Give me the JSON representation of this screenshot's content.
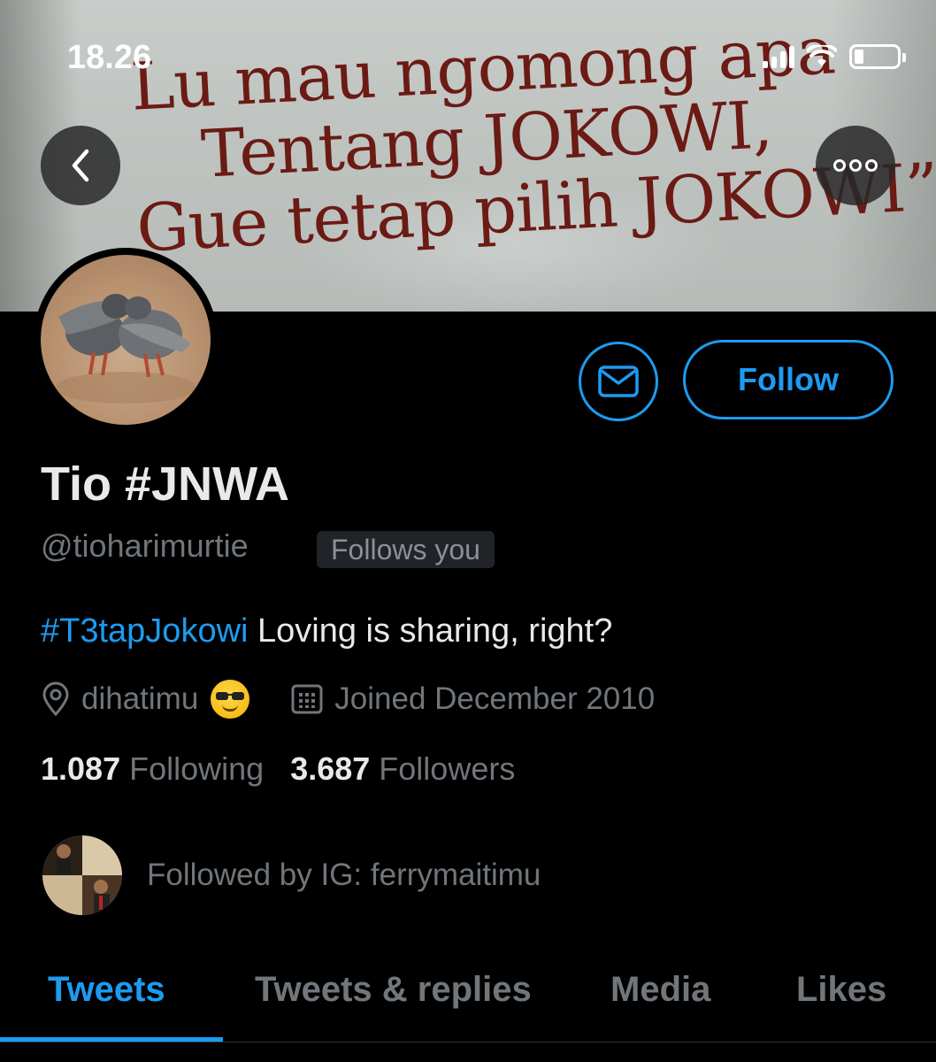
{
  "status_bar": {
    "time": "18.26"
  },
  "banner": {
    "lines": [
      "Lu mau ngomong apa",
      "Tentang JOKOWI,",
      "Gue tetap pilih JOKOWI”"
    ]
  },
  "profile": {
    "display_name": "Tio #JNWA",
    "handle": "@tioharimurtie",
    "follows_you_badge": "Follows you",
    "bio_hashtag": "#T3tapJokowi",
    "bio_text": " Loving is sharing, right?",
    "location": "dihatimu",
    "joined": "Joined December 2010",
    "following_count": "1.087",
    "following_label": "Following",
    "followers_count": "3.687",
    "followers_label": "Followers",
    "followed_by": "Followed by IG: ferrymaitimu"
  },
  "actions": {
    "follow_label": "Follow"
  },
  "tabs": [
    {
      "label": "Tweets",
      "active": true
    },
    {
      "label": "Tweets & replies",
      "active": false
    },
    {
      "label": "Media",
      "active": false
    },
    {
      "label": "Likes",
      "active": false
    }
  ],
  "icons": {
    "back": "chevron-left-icon",
    "more": "more-horizontal-icon",
    "message": "mail-icon",
    "location": "location-pin-icon",
    "calendar": "calendar-icon",
    "emoji": "sunglasses-emoji"
  },
  "colors": {
    "accent": "#1d9bf0",
    "background": "#000000",
    "secondary_text": "#71767b"
  }
}
